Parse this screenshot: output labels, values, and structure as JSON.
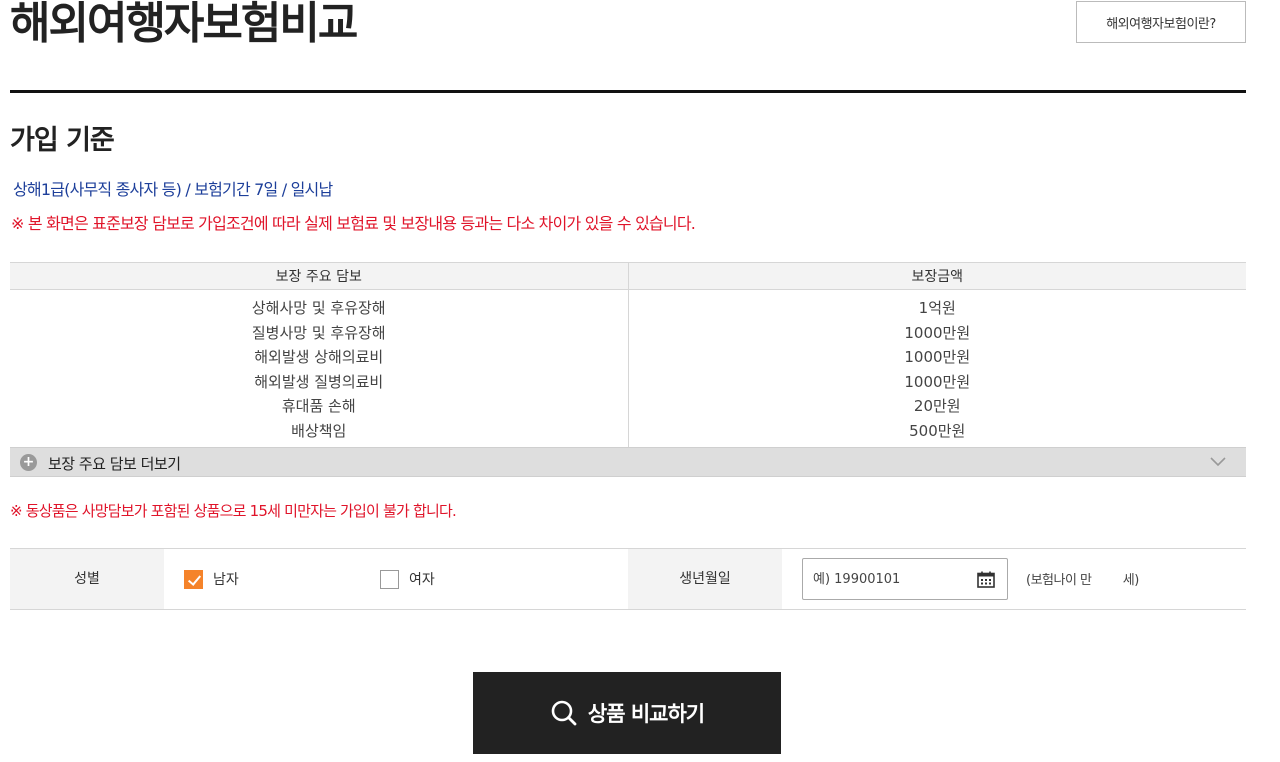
{
  "header": {
    "title": "해외여행자보험비교",
    "info_button": "해외여행자보험이란?"
  },
  "criteria": {
    "section_title": "가입 기준",
    "summary": "상해1급(사무직 종사자 등) / 보험기간 7일 / 일시납",
    "notice": "※ 본 화면은 표준보장 담보로 가입조건에 따라 실제 보험료 및 보장내용 등과는 다소 차이가 있을 수 있습니다."
  },
  "coverage_table": {
    "headers": [
      "보장 주요 담보",
      "보장금액"
    ],
    "rows": [
      {
        "item": "상해사망 및 후유장해",
        "amount": "1억원"
      },
      {
        "item": "질병사망 및 후유장해",
        "amount": "1000만원"
      },
      {
        "item": "해외발생 상해의료비",
        "amount": "1000만원"
      },
      {
        "item": "해외발생 질병의료비",
        "amount": "1000만원"
      },
      {
        "item": "휴대품 손해",
        "amount": "20만원"
      },
      {
        "item": "배상책임",
        "amount": "500만원"
      }
    ],
    "more_label": "보장 주요 담보 더보기"
  },
  "age_notice": "※ 동상품은 사망담보가 포함된 상품으로 15세 미만자는 가입이 불가 합니다.",
  "form": {
    "gender_label": "성별",
    "male_label": "남자",
    "female_label": "여자",
    "male_checked": true,
    "female_checked": false,
    "birth_label": "생년월일",
    "birth_placeholder": "예) 19900101",
    "age_prefix": "(보험나이 만",
    "age_value": "",
    "age_suffix": "세)"
  },
  "actions": {
    "compare_label": "상품 비교하기"
  },
  "icons": {
    "calendar": "calendar-icon",
    "search": "search-icon",
    "plus": "plus-circle-icon",
    "chevron": "chevron-down-icon"
  },
  "colors": {
    "accent_orange": "#f5832a",
    "notice_red": "#e0142a",
    "criteria_blue": "#1d3f9a",
    "button_dark": "#222222"
  }
}
